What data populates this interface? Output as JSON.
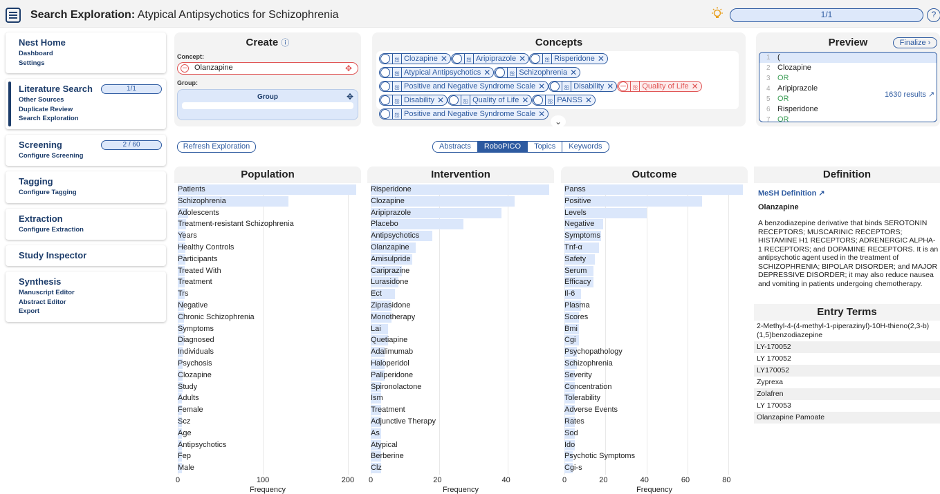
{
  "header": {
    "title_bold": "Search Exploration:",
    "title_rest": " Atypical Antipsychotics for Schizophrenia",
    "progress": "1/1",
    "help": "?"
  },
  "sidebar": [
    {
      "title": "Nest Home",
      "links": [
        "Dashboard",
        "Settings"
      ]
    },
    {
      "title": "Literature Search",
      "pill": "1/1",
      "links": [
        "Other Sources",
        "Duplicate Review",
        "Search Exploration"
      ],
      "active": true
    },
    {
      "title": "Screening",
      "pill": "2 / 60",
      "links": [
        "Configure Screening"
      ]
    },
    {
      "title": "Tagging",
      "links": [
        "Configure Tagging"
      ]
    },
    {
      "title": "Extraction",
      "links": [
        "Configure Extraction"
      ]
    },
    {
      "title": "Study Inspector",
      "links": []
    },
    {
      "title": "Synthesis",
      "links": [
        "Manuscript Editor",
        "Abstract Editor",
        "Export"
      ]
    }
  ],
  "create": {
    "title": "Create",
    "concept_label": "Concept:",
    "concept_value": "Olanzapine",
    "group_label": "Group:",
    "group_name": "Group"
  },
  "concepts": {
    "title": "Concepts",
    "rows": [
      [
        {
          "t": "Clozapine"
        },
        {
          "t": "Aripiprazole"
        },
        {
          "t": "Risperidone"
        }
      ],
      [
        {
          "t": "Atypical Antipsychotics"
        },
        {
          "t": "Schizophrenia"
        }
      ],
      [
        {
          "t": "Positive and Negative Syndrome Scale"
        },
        {
          "t": "Disability"
        },
        {
          "t": "Quality of Life",
          "excluded": true
        }
      ],
      [
        {
          "t": "Disability"
        },
        {
          "t": "Quality of Life"
        },
        {
          "t": "PANSS"
        }
      ],
      [
        {
          "t": "Positive and Negative Syndrome Scale"
        }
      ]
    ]
  },
  "preview": {
    "title": "Preview",
    "finalize": "Finalize",
    "lines": [
      [
        "1",
        "("
      ],
      [
        "2",
        "Clozapine"
      ],
      [
        "3",
        "OR"
      ],
      [
        "4",
        "Aripiprazole"
      ],
      [
        "5",
        "OR"
      ],
      [
        "6",
        "Risperidone"
      ],
      [
        "7",
        "OR"
      ]
    ],
    "results": "1630 results"
  },
  "toolbar": {
    "refresh": "Refresh Exploration",
    "tabs": [
      "Abstracts",
      "RoboPICO",
      "Topics",
      "Keywords"
    ],
    "active_tab": "RoboPICO"
  },
  "chart_data": [
    {
      "type": "bar",
      "title": "Population",
      "xlabel": "Frequency",
      "xlim": [
        0,
        210
      ],
      "ticks": [
        0,
        100,
        200
      ],
      "categories": [
        "Patients",
        "Schizophrenia",
        "Adolescents",
        "Treatment-resistant Schizophrenia",
        "Years",
        "Healthy Controls",
        "Participants",
        "Treated With",
        "Treatment",
        "Trs",
        "Negative",
        "Chronic Schizophrenia",
        "Symptoms",
        "Diagnosed",
        "Individuals",
        "Psychosis",
        "Clozapine",
        "Study",
        "Adults",
        "Female",
        "Scz",
        "Age",
        "Antipsychotics",
        "Fep",
        "Male"
      ],
      "values": [
        210,
        130,
        12,
        10,
        9,
        9,
        9,
        8,
        8,
        8,
        7,
        7,
        7,
        7,
        6,
        6,
        6,
        6,
        5,
        5,
        5,
        5,
        5,
        5,
        5
      ]
    },
    {
      "type": "bar",
      "title": "Intervention",
      "xlabel": "Frequency",
      "xlim": [
        0,
        52
      ],
      "ticks": [
        0,
        20,
        40
      ],
      "categories": [
        "Risperidone",
        "Clozapine",
        "Aripiprazole",
        "Placebo",
        "Antipsychotics",
        "Olanzapine",
        "Amisulpride",
        "Cariprazine",
        "Lurasidone",
        "Ect",
        "Ziprasidone",
        "Monotherapy",
        "Lai",
        "Quetiapine",
        "Adalimumab",
        "Haloperidol",
        "Paliperidone",
        "Spironolactone",
        "Ism",
        "Treatment",
        "Adjunctive Therapy",
        "As",
        "Atypical",
        "Berberine",
        "Clz"
      ],
      "values": [
        52,
        42,
        38,
        27,
        18,
        13,
        12,
        9,
        8,
        7,
        6,
        6,
        5,
        5,
        4,
        4,
        4,
        3,
        3,
        3,
        3,
        3,
        3,
        3,
        3
      ]
    },
    {
      "type": "bar",
      "title": "Outcome",
      "xlabel": "Frequency",
      "xlim": [
        0,
        87
      ],
      "ticks": [
        0,
        20,
        40,
        60,
        80
      ],
      "categories": [
        "Panss",
        "Positive",
        "Levels",
        "Negative",
        "Symptoms",
        "Tnf-α",
        "Safety",
        "Serum",
        "Efficacy",
        "Il-6",
        "Plasma",
        "Scores",
        "Bmi",
        "Cgi",
        "Psychopathology",
        "Schizophrenia",
        "Severity",
        "Concentration",
        "Tolerability",
        "Adverse Events",
        "Rates",
        "Sod",
        "Ido",
        "Psychotic Symptoms",
        "Cgi-s"
      ],
      "values": [
        87,
        67,
        40,
        19,
        18,
        17,
        15,
        14,
        14,
        8,
        8,
        7,
        7,
        7,
        6,
        6,
        5,
        5,
        5,
        5,
        5,
        5,
        5,
        4,
        4
      ]
    }
  ],
  "definition": {
    "title": "Definition",
    "mesh": "MeSH Definition",
    "term": "Olanzapine",
    "text": "A benzodiazepine derivative that binds SEROTONIN RECEPTORS; MUSCARINIC RECEPTORS; HISTAMINE H1 RECEPTORS; ADRENERGIC ALPHA-1 RECEPTORS; and DOPAMINE RECEPTORS. It is an antipsychotic agent used in the treatment of SCHIZOPHRENIA; BIPOLAR DISORDER; and MAJOR DEPRESSIVE DISORDER; it may also reduce nausea and vomiting in patients undergoing chemotherapy.",
    "entry_title": "Entry Terms",
    "entries": [
      "2-Methyl-4-(4-methyl-1-piperazinyl)-10H-thieno(2,3-b)(1,5)benzodiazepine",
      "LY-170052",
      "LY 170052",
      "LY170052",
      "Zyprexa",
      "Zolafren",
      "LY 170053",
      "Olanzapine Pamoate"
    ]
  }
}
